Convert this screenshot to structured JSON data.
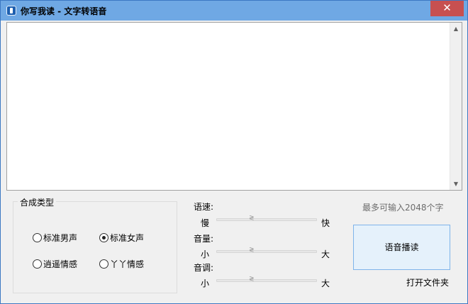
{
  "window": {
    "title": "你写我读 - 文字转语音",
    "close_glyph": "✕"
  },
  "editor": {
    "value": ""
  },
  "voice_group": {
    "label": "合成类型",
    "options": [
      {
        "label": "标准男声",
        "selected": false
      },
      {
        "label": "标准女声",
        "selected": true
      },
      {
        "label": "逍遥情感",
        "selected": false
      },
      {
        "label": "丫丫情感",
        "selected": false
      }
    ]
  },
  "sliders": {
    "speed": {
      "label": "语速:",
      "min_label": "慢",
      "max_label": "快",
      "value": 0.35
    },
    "volume": {
      "label": "音量:",
      "min_label": "小",
      "max_label": "大",
      "value": 0.35
    },
    "pitch": {
      "label": "音调:",
      "min_label": "小",
      "max_label": "大",
      "value": 0.35
    }
  },
  "max_hint": "最多可输入2048个字",
  "play_button": "语音播读",
  "open_folder": "打开文件夹"
}
